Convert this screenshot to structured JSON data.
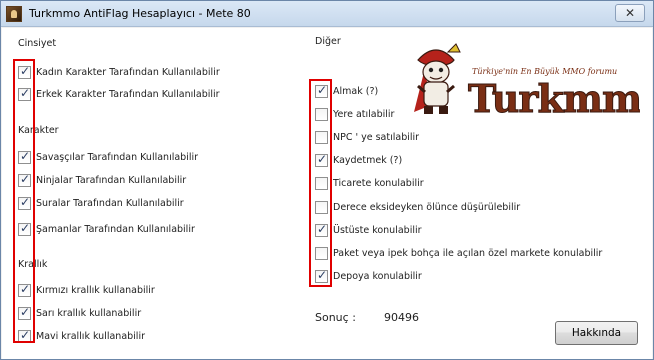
{
  "window": {
    "title": "Turkmmo AntiFlag Hesaplayıcı - Mete 80",
    "close_glyph": "✕"
  },
  "left": {
    "gender_title": "Cinsiyet",
    "gender_items": [
      {
        "label": "Kadın Karakter Tarafından Kullanılabilir",
        "checked": true
      },
      {
        "label": "Erkek Karakter Tarafından Kullanılabilir",
        "checked": true
      }
    ],
    "character_title": "Karakter",
    "character_items": [
      {
        "label": "Savaşçılar Tarafından Kullanılabilir",
        "checked": true
      },
      {
        "label": "Ninjalar Tarafından Kullanılabilir",
        "checked": true
      },
      {
        "label": "Suralar Tarafından Kullanılabilir",
        "checked": true
      },
      {
        "label": "Şamanlar Tarafından Kullanılabilir",
        "checked": true
      }
    ],
    "kingdom_title": "Krallık",
    "kingdom_items": [
      {
        "label": "Kırmızı krallık kullanabilir",
        "checked": true
      },
      {
        "label": "Sarı krallık kullanabilir",
        "checked": true
      },
      {
        "label": "Mavi krallık kullanabilir",
        "checked": true
      }
    ]
  },
  "right": {
    "other_title": "Diğer",
    "other_items": [
      {
        "label": "Almak (?)",
        "checked": true
      },
      {
        "label": "Yere atılabilir",
        "checked": false
      },
      {
        "label": "NPC ' ye satılabilir",
        "checked": false
      },
      {
        "label": "Kaydetmek (?)",
        "checked": true
      },
      {
        "label": "Ticarete konulabilir",
        "checked": false
      },
      {
        "label": "Derece eksideyken ölünce düşürülebilir",
        "checked": false
      },
      {
        "label": "Üstüste konulabilir",
        "checked": true
      },
      {
        "label": "Paket veya ipek bohça ile açılan özel markete konulabilir",
        "checked": false
      },
      {
        "label": "Depoya konulabilir",
        "checked": true
      }
    ]
  },
  "result": {
    "label": "Sonuç :",
    "value": "90496"
  },
  "about_button": "Hakkında",
  "logo": {
    "brand": "Turkmmo",
    "tagline": "Türkiye'nin En Büyük MMO forumu"
  },
  "colors": {
    "highlight": "#e00000",
    "logo_red": "#b5221b",
    "logo_brown": "#7a2e14"
  }
}
